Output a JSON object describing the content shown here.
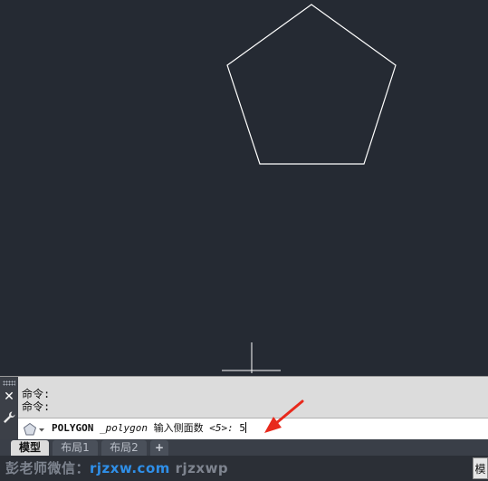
{
  "command_panel": {
    "history": [
      "命令:",
      "命令:"
    ],
    "command_name": "POLYGON",
    "command_alias": "_polygon",
    "prompt": "输入侧面数",
    "default_value": "<5>:",
    "typed_value": "5"
  },
  "tabs": [
    {
      "label": "模型",
      "active": true
    },
    {
      "label": "布局1",
      "active": false
    },
    {
      "label": "布局2",
      "active": false
    },
    {
      "label": "+",
      "active": false
    }
  ],
  "status_bar": {
    "watermark_prefix": "彭老师微信：",
    "watermark_url": "rjzxw.com",
    "watermark_suffix": "rjzxwp",
    "model_button": "模"
  },
  "drawing": {
    "shape": "pentagon",
    "sides": 5,
    "stroke_color": "#ffffff",
    "background_color": "#252a33"
  },
  "colors": {
    "annotation_arrow": "#e8291c",
    "watermark_url": "#2f8fe8"
  },
  "icons": {
    "close": "close-icon",
    "settings": "wrench-icon",
    "command_history": "pentagon-icon",
    "dropdown": "chevron-down-icon"
  }
}
